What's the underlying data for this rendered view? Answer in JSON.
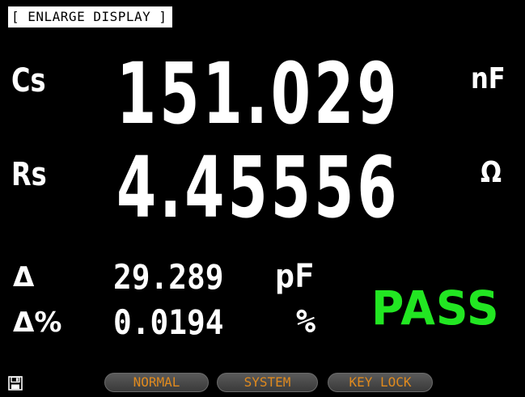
{
  "header": {
    "title": "[ ENLARGE DISPLAY ]"
  },
  "primary": {
    "name": "Cs",
    "value": "151.029",
    "unit": "nF"
  },
  "secondary": {
    "name": "Rs",
    "value": "4.45556",
    "unit": "Ω"
  },
  "deviation": {
    "abs_label": "Δ",
    "abs_value": "29.289",
    "abs_unit": "pF",
    "pct_label": "Δ%",
    "pct_value": "0.0194",
    "pct_unit": "%"
  },
  "judgement": {
    "result": "PASS",
    "color": "#22e622"
  },
  "status_bar": {
    "save_icon": "floppy-disk-icon"
  },
  "softkeys": [
    {
      "label": "NORMAL"
    },
    {
      "label": "SYSTEM"
    },
    {
      "label": "KEY LOCK"
    }
  ],
  "colors": {
    "background": "#000000",
    "text": "#ffffff",
    "softkey_text": "#e08a1e",
    "pass": "#22e622"
  }
}
